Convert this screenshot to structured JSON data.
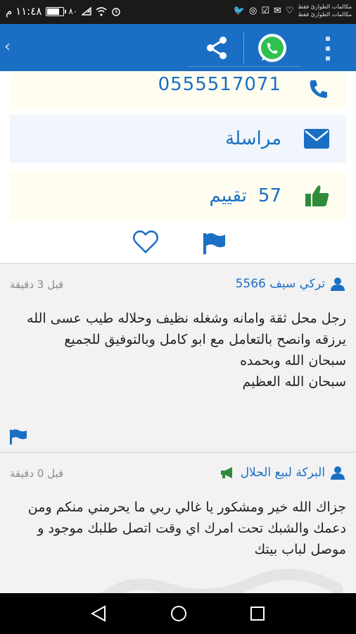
{
  "status_bar": {
    "time": "١١:٤٨ م",
    "battery_level": 0.8,
    "battery_text": "٨٠",
    "notification_lines": [
      "مكالمات الطوارئ فقط",
      "مكالمات الطوارئ فقط"
    ]
  },
  "app_bar": {
    "back_icon": "chevron-left-icon",
    "share_icon": "share-icon",
    "whatsapp_icon": "whatsapp-icon",
    "menu_icon": "overflow-menu-icon",
    "color": "#1a6fc4"
  },
  "contact": {
    "phone": "0555517071",
    "message_label": "مراسلة",
    "rating_count": "57",
    "rating_label": "تقييم"
  },
  "comments": [
    {
      "author": "تركي سيف 5566",
      "time": "قبل 3 دقيقة",
      "lines": [
        "رجل محل ثقة وامانه وشغله نظيف وحلاله طيب عسى الله",
        "يرزقه وانصح بالتعامل مع ابو كامل وبالتوفيق للجميع",
        "سبحان الله وبحمده",
        "سبحان الله العظيم"
      ]
    },
    {
      "author": "البركة لبيع الحلال",
      "time": "قبل 0 دقيقة",
      "lines": [
        "جزاك الله خير ومشكور يا غالي ربي ما يحرمني منكم ومن",
        "دعمك والشبك تحت امرك اي وقت اتصل طلبك موجود و",
        "موصل لباب بيتك"
      ]
    }
  ],
  "colors": {
    "accent": "#1a6fc4",
    "thumb_green": "#2e8b3a",
    "megaphone_green": "#2e8b3a"
  }
}
